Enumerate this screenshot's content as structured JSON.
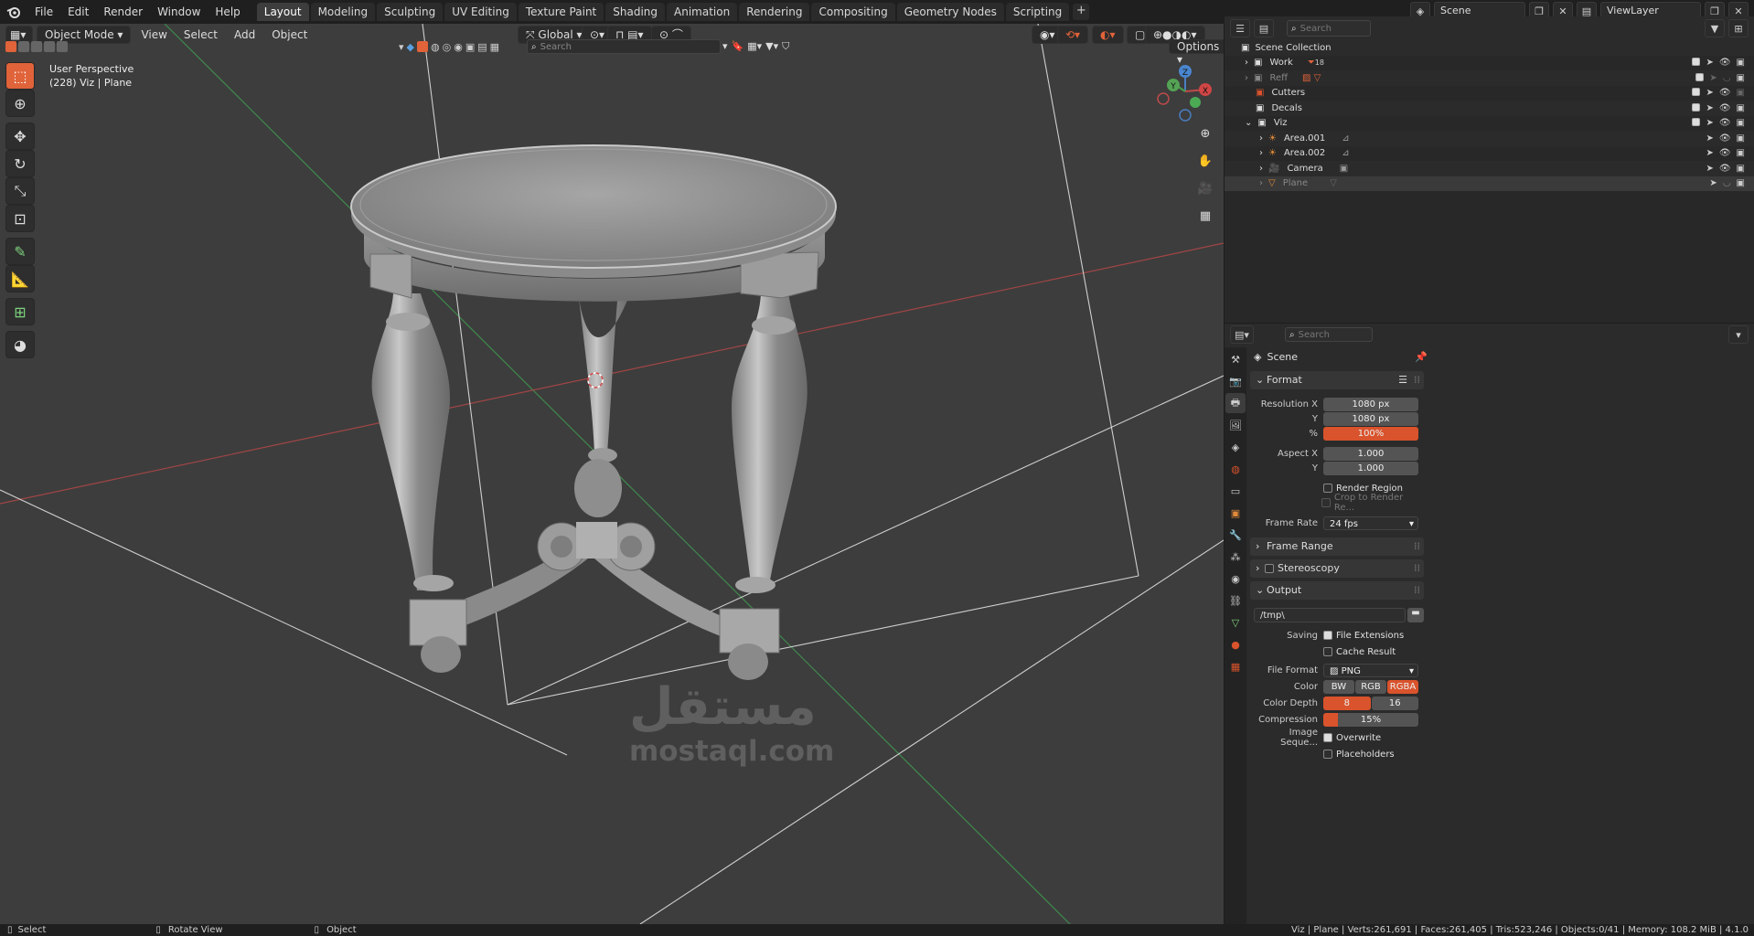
{
  "topbar": {
    "menus": [
      "File",
      "Edit",
      "Render",
      "Window",
      "Help"
    ],
    "workspaces": [
      "Layout",
      "Modeling",
      "Sculpting",
      "UV Editing",
      "Texture Paint",
      "Shading",
      "Animation",
      "Rendering",
      "Compositing",
      "Geometry Nodes",
      "Scripting"
    ],
    "active_workspace": "Layout",
    "scene_name": "Scene",
    "view_layer": "ViewLayer"
  },
  "viewport": {
    "mode": "Object Mode",
    "menus": [
      "View",
      "Select",
      "Add",
      "Object"
    ],
    "transform_orientation": "Global",
    "search_placeholder": "Search",
    "options_label": "Options",
    "info_line1": "User Perspective",
    "info_line2": "(228) Viz | Plane",
    "watermark_ar": "مستقل",
    "watermark_en": "mostaql.com"
  },
  "outliner": {
    "search_placeholder": "Search",
    "items": [
      {
        "name": "Scene Collection",
        "level": 0
      },
      {
        "name": "Work",
        "level": 1,
        "badge": "18"
      },
      {
        "name": "Reff",
        "level": 1
      },
      {
        "name": "Cutters",
        "level": 1
      },
      {
        "name": "Decals",
        "level": 1
      },
      {
        "name": "Viz",
        "level": 1
      },
      {
        "name": "Area.001",
        "level": 2
      },
      {
        "name": "Area.002",
        "level": 2
      },
      {
        "name": "Camera",
        "level": 2
      },
      {
        "name": "Plane",
        "level": 2
      }
    ]
  },
  "properties": {
    "search_placeholder": "Search",
    "context": "Scene",
    "format_panel": "Format",
    "resolution_x_label": "Resolution X",
    "resolution_x": "1080 px",
    "y_label": "Y",
    "resolution_y": "1080 px",
    "percent_label": "%",
    "resolution_percent": "100%",
    "aspect_x_label": "Aspect X",
    "aspect_x": "1.000",
    "aspect_y": "1.000",
    "render_region": "Render Region",
    "crop_region": "Crop to Render Re...",
    "frame_rate_label": "Frame Rate",
    "frame_rate": "24 fps",
    "frame_range_panel": "Frame Range",
    "stereoscopy_panel": "Stereoscopy",
    "output_panel": "Output",
    "output_path": "/tmp\\",
    "saving_label": "Saving",
    "file_extensions": "File Extensions",
    "cache_result": "Cache Result",
    "file_format_label": "File Format",
    "file_format": "PNG",
    "color_label": "Color",
    "color_options": [
      "BW",
      "RGB",
      "RGBA"
    ],
    "color_active": "RGBA",
    "color_depth_label": "Color Depth",
    "color_depth_options": [
      "8",
      "16"
    ],
    "color_depth_active": "8",
    "compression_label": "Compression",
    "compression": "15%",
    "compression_fraction": 0.15,
    "image_sequence_label": "Image Seque...",
    "overwrite": "Overwrite",
    "placeholders": "Placeholders"
  },
  "statusbar": {
    "select": "Select",
    "rotate": "Rotate View",
    "object": "Object",
    "stats": "Viz | Plane | Verts:261,691 | Faces:261,405 | Tris:523,246 | Objects:0/41 | Memory: 108.2 MiB | 4.1.0"
  },
  "colors": {
    "accent": "#e0633a",
    "viewport_bg": "#3d3d3d",
    "x_axis": "#b84a4a",
    "y_axis": "#3d8a4a"
  }
}
